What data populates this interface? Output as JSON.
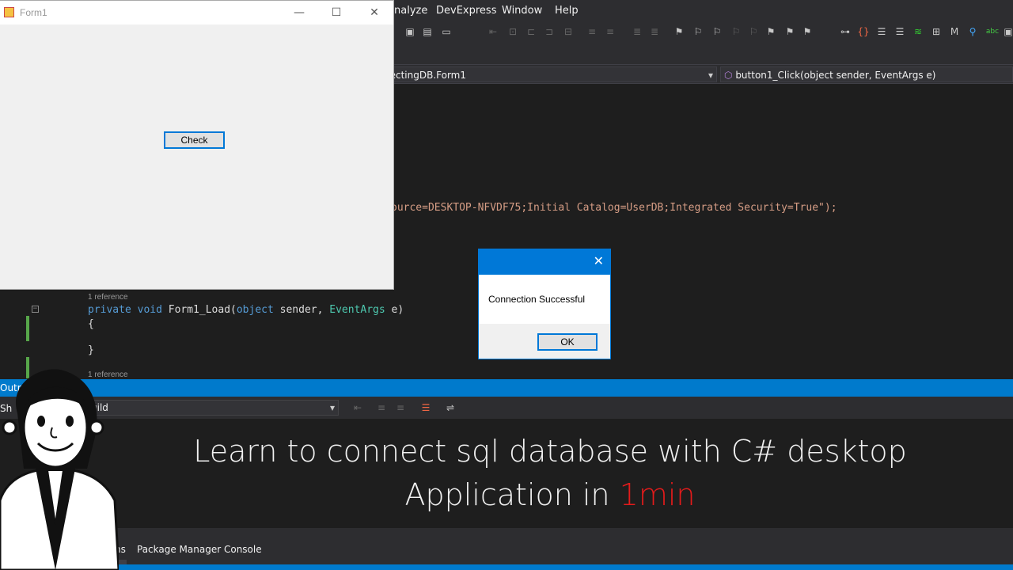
{
  "menubar": {
    "items": [
      "nalyze",
      "DevExpress",
      "Window",
      "Help"
    ]
  },
  "navbar": {
    "class_label": "nectingDB.Form1",
    "method_label": "button1_Click(object sender, EventArgs e)"
  },
  "editor": {
    "connection_line": "ource=DESKTOP-NFVDF75;Initial Catalog=UserDB;Integrated Security=True\");",
    "ref_label": "1 reference",
    "method_line_kw": "private void",
    "method_line_name": " Form1_Load(",
    "method_line_kw2": "object",
    "method_line_mid": " sender, ",
    "method_line_type": "EventArgs",
    "method_line_end": " e)",
    "open_brace": "{",
    "close_brace": "}",
    "ref_label_2": "1 reference"
  },
  "form1": {
    "title": "Form1",
    "check_button": "Check",
    "minimize": "—",
    "maximize": "☐",
    "close": "✕"
  },
  "msgbox": {
    "message": "Connection Successful",
    "ok_label": "OK",
    "close": "✕"
  },
  "output": {
    "header_label": "Outp",
    "show_label": "Sh",
    "combo_value": "uild"
  },
  "overlay": {
    "line1": "Learn to connect sql database with C# desktop",
    "line2_prefix": "Application in ",
    "line2_highlight": "1min"
  },
  "bottom_tabs": {
    "tab1": "ns",
    "tab2": "Package Manager Console"
  },
  "colors": {
    "accent": "#007acc",
    "highlight_red": "#e51b1b"
  }
}
